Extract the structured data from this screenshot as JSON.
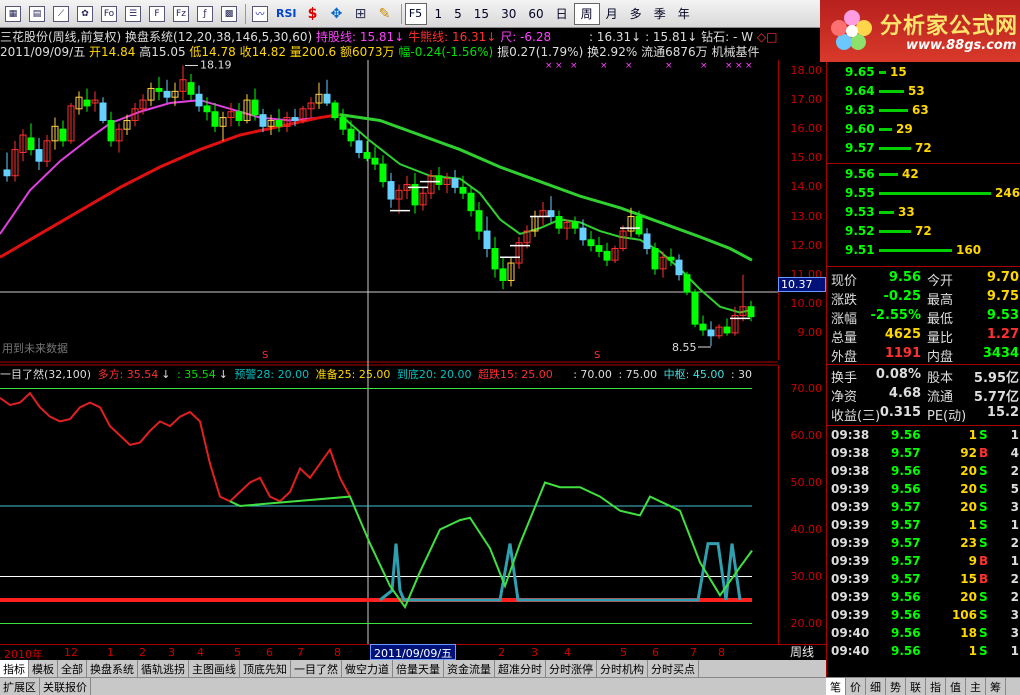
{
  "toolbar": {
    "icons": [
      "grid-icon",
      "table-icon",
      "line-chart-icon",
      "flower-icon",
      "fo-icon",
      "list-icon",
      "f10-icon",
      "fiz-icon",
      "fx-icon",
      "calc-icon"
    ],
    "rsi_label": "RSI",
    "f5_label": "F5",
    "periods": [
      "1",
      "5",
      "15",
      "30",
      "60",
      "日",
      "周",
      "月",
      "多",
      "季",
      "年"
    ],
    "active_period": "周"
  },
  "logo": {
    "title": "分析家公式网",
    "url": "www.88gs.com"
  },
  "header": {
    "line1": {
      "name": "三花股份(周线,前复权)",
      "system": "换盘系统(12,20,38,146,5,30,60)",
      "holding": "持股线: 15.81",
      "niu": "牛熊线: 16.31",
      "chi": "尺: -6.28",
      "v1": ": 16.31",
      "v2": ": 15.81",
      "zuanshi": "钻石: -",
      "w": "W"
    },
    "line2": {
      "date": "2011/09/09/五",
      "open": "开14.84",
      "high": "高15.05",
      "low": "低14.78",
      "close": "收14.82",
      "vol": "量200.6",
      "amount": "额6073万",
      "change": "幅-0.24(-1.56%)",
      "amplitude": "振0.27(1.79%)",
      "turnover": "换2.92%",
      "float": "流通6876万",
      "machine": "机械基件"
    }
  },
  "annotations": {
    "high": "18.19",
    "low": "8.55",
    "future_data": "用到未来数据",
    "marker_s": "S"
  },
  "axis": {
    "main": [
      "18.00",
      "17.00",
      "16.00",
      "15.00",
      "14.00",
      "13.00",
      "12.00",
      "11.00",
      "10.00",
      "9.00"
    ],
    "cursor_price": "10.37",
    "indicator": [
      "70.00",
      "60.00",
      "50.00",
      "40.00",
      "30.00",
      "20.00"
    ]
  },
  "indicator_legend": {
    "name": "一目了然(32,100)",
    "duofang": "多方: 35.54",
    "v2": ": 35.54",
    "yujing": "预警28: 20.00",
    "zhunbei": "准备25: 25.00",
    "daodi": "到底20: 20.00",
    "chaotie": "超跌15: 25.00",
    "v70": ": 70.00",
    "v75": ": 75.00",
    "zhongshu": "中枢: 45.00",
    "v30": ": 30"
  },
  "date_axis": {
    "labels": [
      "2010年",
      "12",
      "1",
      "2",
      "3",
      "4",
      "5",
      "6",
      "7",
      "8",
      "2011/09/09/五",
      "2",
      "3",
      "4",
      "5",
      "6",
      "7",
      "8"
    ],
    "period_label": "周线"
  },
  "tabs": [
    "指标",
    "模板",
    "全部",
    "换盘系统",
    "循轨逃拐",
    "主图画线",
    "顶底先知",
    "一目了然",
    "做空力道",
    "倍量天量",
    "资金流量",
    "超准分时",
    "分时涨停",
    "分时机构",
    "分时买点"
  ],
  "active_tab": "指标",
  "tabs2": [
    "扩展区",
    "关联报价"
  ],
  "right_tabs": [
    "笔",
    "价",
    "细",
    "势",
    "联",
    "指",
    "值",
    "主",
    "筹"
  ],
  "order_book": {
    "sell": [
      {
        "price": "9.65",
        "vol": "15",
        "ratio": 0.06
      },
      {
        "price": "9.64",
        "vol": "53",
        "ratio": 0.22
      },
      {
        "price": "9.63",
        "vol": "63",
        "ratio": 0.26
      },
      {
        "price": "9.60",
        "vol": "29",
        "ratio": 0.12
      },
      {
        "price": "9.57",
        "vol": "72",
        "ratio": 0.29
      }
    ],
    "buy": [
      {
        "price": "9.56",
        "vol": "42",
        "ratio": 0.17
      },
      {
        "price": "9.55",
        "vol": "246",
        "ratio": 1.0
      },
      {
        "price": "9.53",
        "vol": "33",
        "ratio": 0.13
      },
      {
        "price": "9.52",
        "vol": "72",
        "ratio": 0.29
      },
      {
        "price": "9.51",
        "vol": "160",
        "ratio": 0.65
      }
    ]
  },
  "quote": {
    "xianjia_l": "现价",
    "xianjia": "9.56",
    "jinkai_l": "今开",
    "jinkai": "9.70",
    "zhangdie_l": "涨跌",
    "zhangdie": "-0.25",
    "zuigao_l": "最高",
    "zuigao": "9.75",
    "zhangfu_l": "涨幅",
    "zhangfu": "-2.55%",
    "zuidi_l": "最低",
    "zuidi": "9.53",
    "zongliang_l": "总量",
    "zongliang": "4625",
    "liangbi_l": "量比",
    "liangbi": "1.27",
    "waipan_l": "外盘",
    "waipan": "1191",
    "neipan_l": "内盘",
    "neipan": "3434",
    "huanshou_l": "换手",
    "huanshou": "0.08%",
    "guben_l": "股本",
    "guben": "5.95亿",
    "jingzi_l": "净资",
    "jingzi": "4.68",
    "liutong_l": "流通",
    "liutong": "5.77亿",
    "shouyi_l": "收益(三)",
    "shouyi": "0.315",
    "pe_l": "PE(动)",
    "pe": "15.2"
  },
  "trades": [
    {
      "time": "09:38",
      "price": "9.56",
      "vol": "1",
      "side": "S",
      "extra": "1"
    },
    {
      "time": "09:38",
      "price": "9.57",
      "vol": "92",
      "side": "B",
      "extra": "4"
    },
    {
      "time": "09:38",
      "price": "9.56",
      "vol": "20",
      "side": "S",
      "extra": "2"
    },
    {
      "time": "09:39",
      "price": "9.56",
      "vol": "20",
      "side": "S",
      "extra": "5"
    },
    {
      "time": "09:39",
      "price": "9.57",
      "vol": "20",
      "side": "S",
      "extra": "3"
    },
    {
      "time": "09:39",
      "price": "9.57",
      "vol": "1",
      "side": "S",
      "extra": "1"
    },
    {
      "time": "09:39",
      "price": "9.57",
      "vol": "23",
      "side": "S",
      "extra": "2"
    },
    {
      "time": "09:39",
      "price": "9.57",
      "vol": "9",
      "side": "B",
      "extra": "1"
    },
    {
      "time": "09:39",
      "price": "9.57",
      "vol": "15",
      "side": "B",
      "extra": "2"
    },
    {
      "time": "09:39",
      "price": "9.56",
      "vol": "20",
      "side": "S",
      "extra": "2"
    },
    {
      "time": "09:39",
      "price": "9.56",
      "vol": "106",
      "side": "S",
      "extra": "3"
    },
    {
      "time": "09:40",
      "price": "9.56",
      "vol": "18",
      "side": "S",
      "extra": "3"
    },
    {
      "time": "09:40",
      "price": "9.56",
      "vol": "1",
      "side": "S",
      "extra": "1"
    }
  ],
  "colors": {
    "up": "#ff3030",
    "down": "#00ff00",
    "ma_pink": "#e040e0",
    "ma_red": "#e01010",
    "ma_green": "#30d030",
    "ind_red": "#e02020",
    "ind_green": "#40e040",
    "ind_cyan": "#30a0b0"
  },
  "candles": [
    [
      7,
      14.6,
      15.2,
      14.2,
      14.4
    ],
    [
      15,
      14.4,
      15.6,
      14.2,
      15.3
    ],
    [
      23,
      15.2,
      16.0,
      14.9,
      15.8
    ],
    [
      31,
      15.7,
      16.2,
      15.1,
      15.3
    ],
    [
      39,
      15.3,
      15.7,
      14.6,
      14.9
    ],
    [
      47,
      14.9,
      15.8,
      14.7,
      15.6
    ],
    [
      55,
      15.6,
      16.4,
      15.3,
      16.1
    ],
    [
      63,
      16.0,
      16.3,
      15.4,
      15.6
    ],
    [
      71,
      15.6,
      16.9,
      15.5,
      16.8
    ],
    [
      79,
      16.7,
      17.3,
      16.5,
      17.1
    ],
    [
      87,
      17.0,
      17.4,
      16.6,
      16.8
    ],
    [
      95,
      16.9,
      17.3,
      16.6,
      17.0
    ],
    [
      103,
      16.9,
      17.1,
      16.2,
      16.3
    ],
    [
      111,
      16.3,
      16.6,
      15.4,
      15.6
    ],
    [
      119,
      15.6,
      16.2,
      15.2,
      16.0
    ],
    [
      127,
      16.0,
      16.5,
      15.8,
      16.3
    ],
    [
      135,
      16.3,
      16.9,
      16.1,
      16.7
    ],
    [
      143,
      16.7,
      17.2,
      16.5,
      17.0
    ],
    [
      151,
      17.0,
      17.6,
      16.8,
      17.4
    ],
    [
      159,
      17.4,
      17.8,
      17.0,
      17.3
    ],
    [
      167,
      17.3,
      17.7,
      16.9,
      17.1
    ],
    [
      175,
      17.1,
      17.6,
      16.8,
      17.3
    ],
    [
      183,
      17.3,
      18.19,
      17.0,
      17.7
    ],
    [
      191,
      17.6,
      17.9,
      17.0,
      17.2
    ],
    [
      199,
      17.2,
      17.5,
      16.6,
      16.8
    ],
    [
      207,
      16.8,
      17.1,
      16.3,
      16.6
    ],
    [
      215,
      16.6,
      16.9,
      15.9,
      16.1
    ],
    [
      223,
      16.1,
      16.6,
      15.6,
      16.4
    ],
    [
      231,
      16.4,
      16.9,
      16.1,
      16.6
    ],
    [
      239,
      16.6,
      16.9,
      16.1,
      16.3
    ],
    [
      247,
      16.3,
      17.2,
      16.2,
      17.0
    ],
    [
      255,
      17.0,
      17.4,
      16.3,
      16.5
    ],
    [
      263,
      16.5,
      16.7,
      15.9,
      16.1
    ],
    [
      271,
      16.1,
      16.5,
      15.8,
      16.3
    ],
    [
      279,
      16.3,
      16.7,
      15.9,
      16.1
    ],
    [
      287,
      16.1,
      16.6,
      15.9,
      16.4
    ],
    [
      295,
      16.4,
      16.7,
      16.1,
      16.3
    ],
    [
      303,
      16.3,
      16.8,
      16.2,
      16.7
    ],
    [
      311,
      16.7,
      17.1,
      16.4,
      16.9
    ],
    [
      319,
      16.9,
      17.6,
      16.7,
      17.2
    ],
    [
      327,
      17.2,
      17.7,
      16.8,
      16.9
    ],
    [
      335,
      16.9,
      17.0,
      16.3,
      16.4
    ],
    [
      343,
      16.4,
      16.7,
      15.8,
      16.0
    ],
    [
      351,
      16.0,
      16.3,
      15.4,
      15.6
    ],
    [
      359,
      15.6,
      15.9,
      15.0,
      15.2
    ],
    [
      367,
      15.2,
      15.6,
      14.9,
      15.0
    ],
    [
      375,
      15.0,
      15.4,
      14.6,
      14.8
    ],
    [
      383,
      14.8,
      15.1,
      14.0,
      14.2
    ],
    [
      391,
      14.2,
      14.5,
      13.3,
      13.6
    ],
    [
      399,
      13.6,
      14.1,
      13.1,
      13.9
    ],
    [
      407,
      13.9,
      14.4,
      13.6,
      14.1
    ],
    [
      415,
      14.1,
      14.5,
      13.1,
      13.4
    ],
    [
      423,
      13.4,
      14.0,
      13.2,
      13.8
    ],
    [
      431,
      13.8,
      14.6,
      13.6,
      14.4
    ],
    [
      439,
      14.4,
      14.7,
      13.9,
      14.1
    ],
    [
      447,
      14.1,
      14.5,
      13.8,
      14.3
    ],
    [
      455,
      14.3,
      14.6,
      13.8,
      14.0
    ],
    [
      463,
      14.0,
      14.4,
      13.6,
      13.8
    ],
    [
      471,
      13.8,
      14.0,
      13.0,
      13.2
    ],
    [
      479,
      13.2,
      13.5,
      12.2,
      12.5
    ],
    [
      487,
      12.5,
      13.0,
      11.6,
      11.9
    ],
    [
      495,
      11.9,
      12.3,
      10.9,
      11.2
    ],
    [
      503,
      11.2,
      11.6,
      10.5,
      10.8
    ],
    [
      511,
      10.8,
      11.6,
      10.6,
      11.4
    ],
    [
      519,
      11.4,
      12.3,
      11.2,
      12.1
    ],
    [
      527,
      12.1,
      12.7,
      11.9,
      12.5
    ],
    [
      535,
      12.5,
      13.2,
      12.3,
      13.0
    ],
    [
      543,
      13.0,
      13.5,
      12.7,
      13.2
    ],
    [
      551,
      13.2,
      13.7,
      12.8,
      13.0
    ],
    [
      559,
      13.0,
      13.2,
      12.4,
      12.6
    ],
    [
      567,
      12.6,
      12.9,
      12.2,
      12.8
    ],
    [
      575,
      12.8,
      13.0,
      12.4,
      12.6
    ],
    [
      583,
      12.6,
      12.9,
      12.0,
      12.2
    ],
    [
      591,
      12.2,
      12.5,
      11.8,
      12.0
    ],
    [
      599,
      12.0,
      12.3,
      11.6,
      11.8
    ],
    [
      607,
      11.8,
      12.1,
      11.3,
      11.5
    ],
    [
      615,
      11.5,
      12.0,
      11.4,
      11.9
    ],
    [
      623,
      11.9,
      12.7,
      11.8,
      12.5
    ],
    [
      631,
      12.5,
      13.3,
      12.3,
      13.0
    ],
    [
      639,
      13.0,
      13.2,
      12.3,
      12.4
    ],
    [
      647,
      12.4,
      12.6,
      11.7,
      11.9
    ],
    [
      655,
      11.9,
      12.1,
      11.0,
      11.2
    ],
    [
      663,
      11.2,
      11.8,
      10.9,
      11.6
    ],
    [
      671,
      11.6,
      11.9,
      11.3,
      11.5
    ],
    [
      679,
      11.5,
      11.7,
      10.8,
      11.0
    ],
    [
      687,
      11.0,
      11.1,
      10.3,
      10.4
    ],
    [
      695,
      10.4,
      10.5,
      9.2,
      9.3
    ],
    [
      703,
      9.3,
      9.6,
      8.9,
      9.1
    ],
    [
      711,
      9.1,
      9.4,
      8.55,
      8.9
    ],
    [
      719,
      8.9,
      9.3,
      8.8,
      9.2
    ],
    [
      727,
      9.2,
      9.5,
      8.9,
      9.0
    ],
    [
      735,
      9.0,
      9.9,
      8.9,
      9.6
    ],
    [
      743,
      9.6,
      11.0,
      9.4,
      9.9
    ],
    [
      751,
      9.9,
      10.1,
      9.4,
      9.56
    ]
  ],
  "ma_pink": [
    [
      0,
      12.4
    ],
    [
      30,
      13.9
    ],
    [
      60,
      14.9
    ],
    [
      90,
      15.7
    ],
    [
      110,
      16.2
    ],
    [
      140,
      16.6
    ],
    [
      170,
      16.9
    ],
    [
      200,
      17.0
    ],
    [
      230,
      16.7
    ],
    [
      260,
      16.4
    ],
    [
      290,
      16.3
    ],
    [
      320,
      16.4
    ],
    [
      340,
      16.5
    ]
  ],
  "ma_red": [
    [
      0,
      11.6
    ],
    [
      40,
      12.4
    ],
    [
      80,
      13.2
    ],
    [
      120,
      14.0
    ],
    [
      160,
      14.7
    ],
    [
      200,
      15.3
    ],
    [
      240,
      15.8
    ],
    [
      280,
      16.1
    ],
    [
      320,
      16.4
    ],
    [
      340,
      16.5
    ]
  ],
  "ma_green_long": [
    [
      340,
      16.5
    ],
    [
      380,
      16.3
    ],
    [
      420,
      15.8
    ],
    [
      460,
      15.3
    ],
    [
      500,
      14.7
    ],
    [
      540,
      14.2
    ],
    [
      580,
      13.7
    ],
    [
      620,
      13.3
    ],
    [
      660,
      12.8
    ],
    [
      700,
      12.3
    ],
    [
      730,
      11.9
    ],
    [
      752,
      11.5
    ]
  ],
  "ma_green_short": [
    [
      340,
      16.5
    ],
    [
      370,
      15.6
    ],
    [
      400,
      14.8
    ],
    [
      430,
      14.4
    ],
    [
      460,
      14.3
    ],
    [
      480,
      13.8
    ],
    [
      500,
      12.9
    ],
    [
      520,
      12.4
    ],
    [
      540,
      12.6
    ],
    [
      560,
      12.9
    ],
    [
      580,
      12.8
    ],
    [
      600,
      12.5
    ],
    [
      620,
      12.3
    ],
    [
      640,
      12.2
    ],
    [
      660,
      11.8
    ],
    [
      680,
      11.2
    ],
    [
      700,
      10.5
    ],
    [
      720,
      9.9
    ],
    [
      740,
      9.7
    ],
    [
      752,
      9.8
    ]
  ],
  "ind_red": [
    [
      0,
      68
    ],
    [
      10,
      66.5
    ],
    [
      20,
      67
    ],
    [
      30,
      69
    ],
    [
      40,
      66
    ],
    [
      50,
      64
    ],
    [
      60,
      63
    ],
    [
      70,
      63.5
    ],
    [
      80,
      66
    ],
    [
      90,
      67
    ],
    [
      100,
      66
    ],
    [
      110,
      62
    ],
    [
      120,
      60
    ],
    [
      130,
      58
    ],
    [
      140,
      58.5
    ],
    [
      150,
      61
    ],
    [
      160,
      63
    ],
    [
      170,
      62
    ],
    [
      180,
      64
    ],
    [
      190,
      65
    ],
    [
      200,
      63
    ],
    [
      210,
      54
    ],
    [
      220,
      47
    ],
    [
      230,
      46
    ],
    [
      240,
      48
    ],
    [
      250,
      50
    ],
    [
      260,
      51
    ],
    [
      270,
      47
    ],
    [
      280,
      46
    ],
    [
      290,
      48
    ],
    [
      300,
      53
    ],
    [
      310,
      51
    ],
    [
      320,
      54
    ],
    [
      330,
      57
    ],
    [
      340,
      51
    ],
    [
      350,
      47
    ]
  ],
  "ind_green": [
    [
      230,
      46
    ],
    [
      240,
      45
    ],
    [
      350,
      47
    ],
    [
      370,
      37
    ],
    [
      390,
      28
    ],
    [
      405,
      23.5
    ],
    [
      420,
      31
    ],
    [
      440,
      40
    ],
    [
      460,
      42
    ],
    [
      470,
      42.5
    ],
    [
      490,
      36
    ],
    [
      505,
      28
    ],
    [
      520,
      37
    ],
    [
      545,
      50
    ],
    [
      560,
      49
    ],
    [
      580,
      49
    ],
    [
      600,
      47
    ],
    [
      620,
      44
    ],
    [
      640,
      43
    ],
    [
      650,
      47
    ],
    [
      660,
      46
    ],
    [
      680,
      44
    ],
    [
      700,
      33
    ],
    [
      720,
      26
    ],
    [
      740,
      32
    ],
    [
      752,
      35.5
    ]
  ],
  "ind_cyan": [
    [
      380,
      25
    ],
    [
      392,
      27
    ],
    [
      396,
      37
    ],
    [
      400,
      27
    ],
    [
      404,
      25
    ],
    [
      500,
      25
    ],
    [
      510,
      37
    ],
    [
      518,
      25
    ],
    [
      698,
      25
    ],
    [
      708,
      37
    ],
    [
      718,
      37
    ],
    [
      726,
      25
    ],
    [
      732,
      37
    ],
    [
      740,
      25
    ]
  ]
}
